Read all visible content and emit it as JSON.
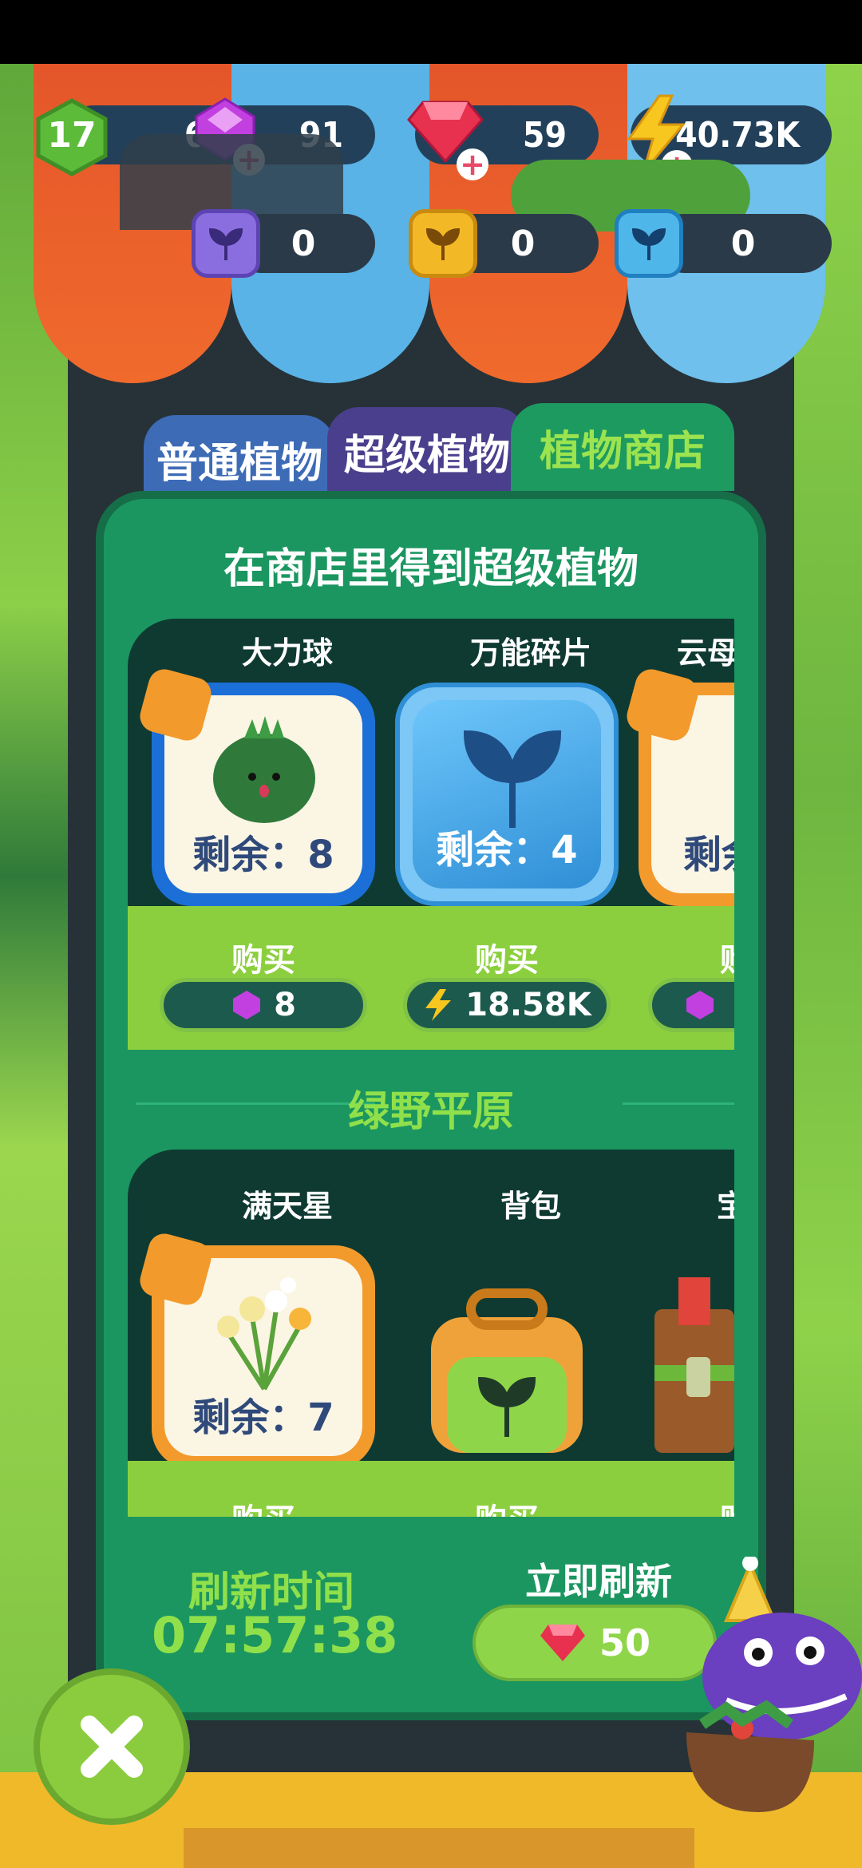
{
  "header": {
    "level": "17",
    "resources": {
      "purple_gems": "65",
      "purple_gems_right": "91",
      "red_gems": "59",
      "energy": "40.73K"
    },
    "seeds": {
      "purple_seeds": "0",
      "gold_seeds": "0",
      "blue_seeds": "0"
    }
  },
  "tabs": [
    {
      "label": "普通植物"
    },
    {
      "label": "超级植物"
    },
    {
      "label": "植物商店"
    }
  ],
  "shop": {
    "title": "在商店里得到超级植物",
    "row1": {
      "items": [
        {
          "name": "大力球",
          "remaining": "剩余：8",
          "buy_label": "购买",
          "price": "8",
          "currency": "purple-gem"
        },
        {
          "name": "万能碎片",
          "remaining": "剩余：4",
          "buy_label": "购买",
          "price": "18.58K",
          "currency": "energy"
        },
        {
          "name": "云母",
          "remaining": "剩余",
          "buy_label": "购",
          "price": "",
          "currency": "purple-gem"
        }
      ]
    },
    "section_title": "绿野平原",
    "row2": {
      "items": [
        {
          "name": "满天星",
          "remaining": "剩余：7",
          "buy_label": "购买"
        },
        {
          "name": "背包",
          "buy_label": "购买"
        },
        {
          "name": "宝",
          "buy_label": "购"
        }
      ]
    }
  },
  "refresh": {
    "label": "刷新时间",
    "time": "07:57:38",
    "now_label": "立即刷新",
    "cost": "50"
  },
  "colors": {
    "panel_green": "#1b9660",
    "accent_lime": "#8fe04a",
    "awning_orange": "#f06a2c",
    "awning_blue": "#59b3e6"
  }
}
